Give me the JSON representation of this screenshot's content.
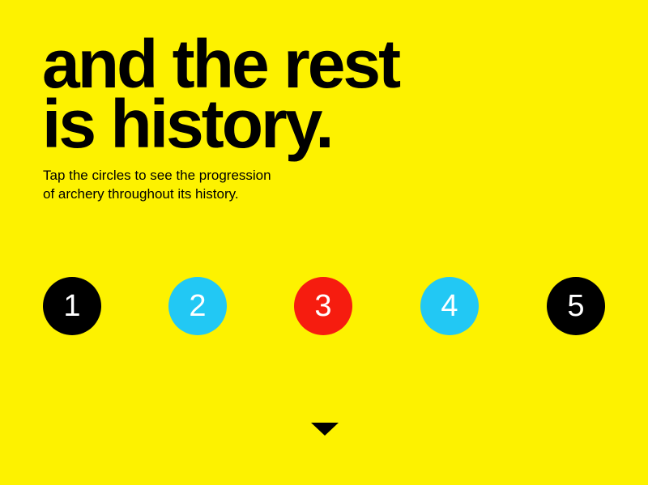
{
  "headline": {
    "line1": "and the rest",
    "line2": "is history."
  },
  "subtitle": {
    "line1": "Tap the circles to see the progression",
    "line2": "of archery throughout its history."
  },
  "circles": [
    {
      "label": "1",
      "color": "#000000"
    },
    {
      "label": "2",
      "color": "#22c8f4"
    },
    {
      "label": "3",
      "color": "#f61c0f"
    },
    {
      "label": "4",
      "color": "#22c8f4"
    },
    {
      "label": "5",
      "color": "#000000"
    }
  ],
  "colors": {
    "background": "#fdf200",
    "text": "#000000"
  },
  "next_arrow": {
    "icon": "down-triangle-icon"
  }
}
